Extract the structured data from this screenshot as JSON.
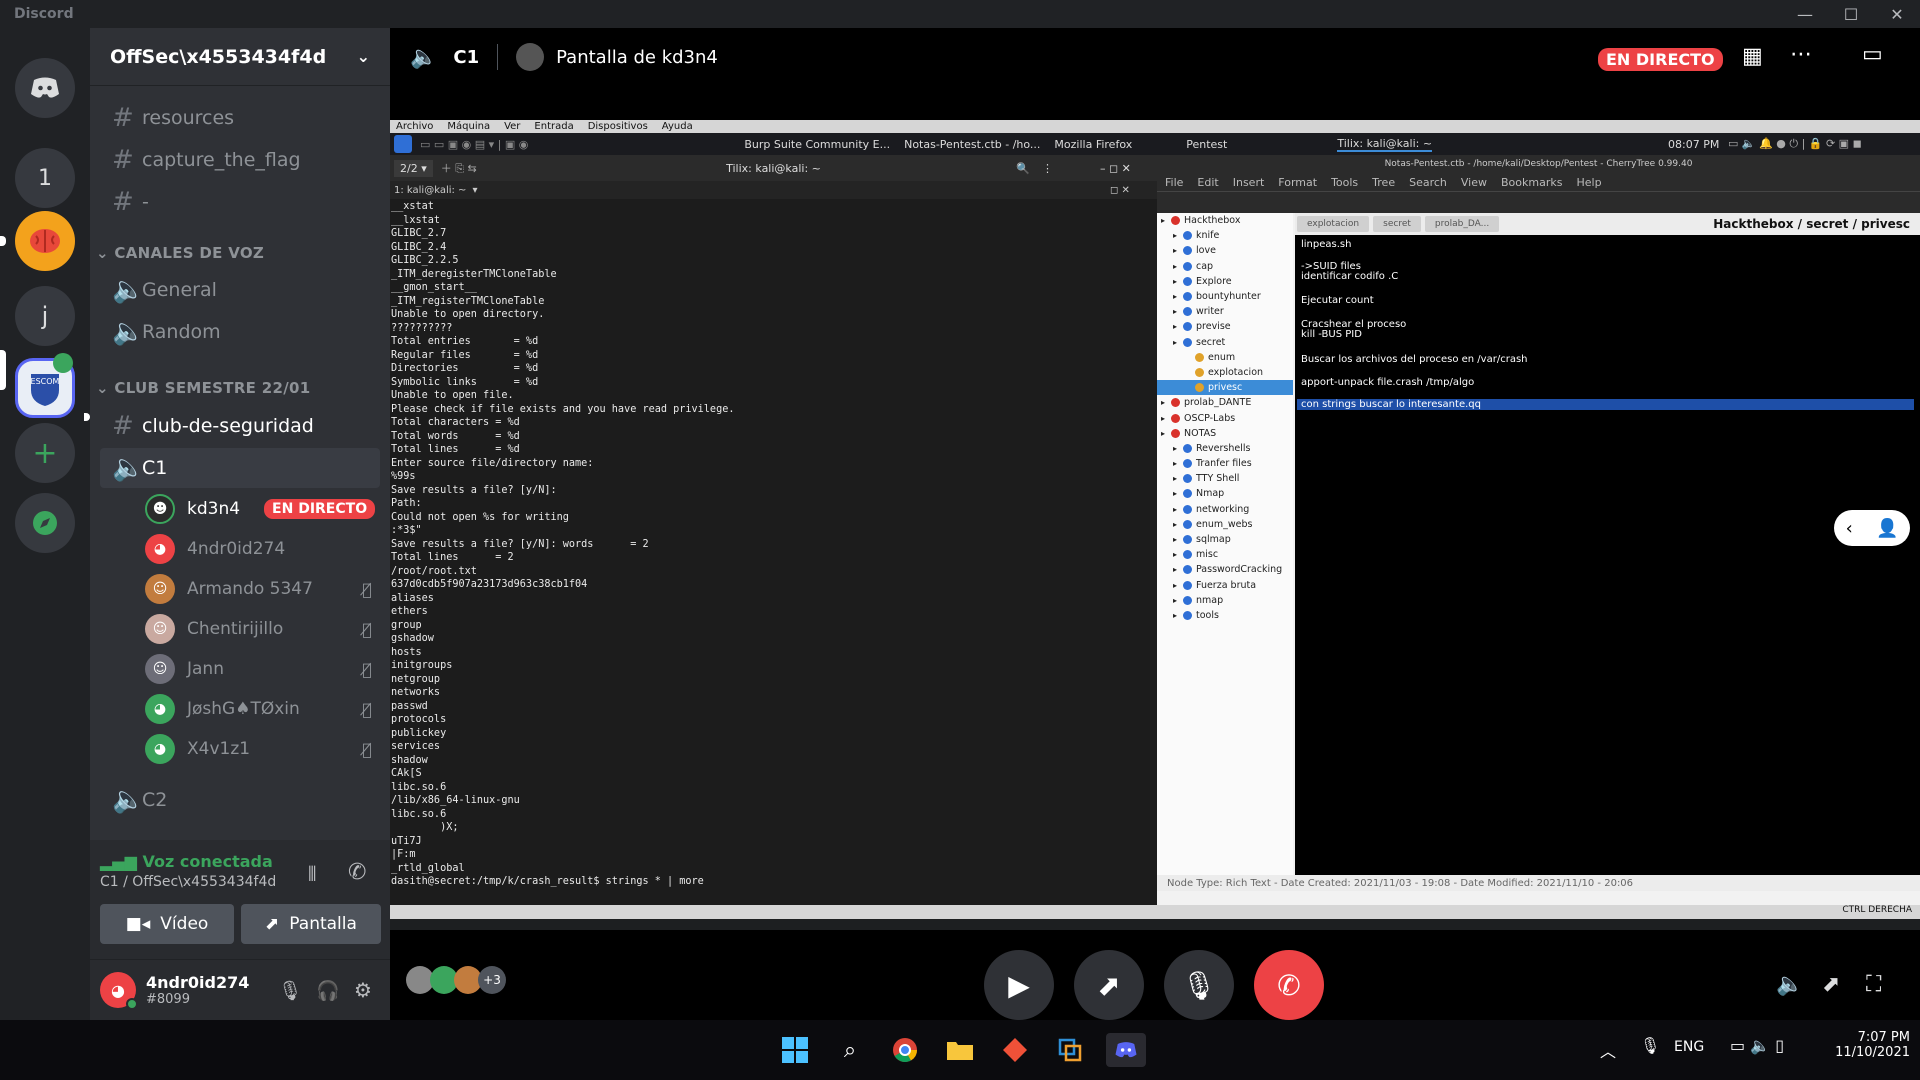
{
  "window": {
    "app_name": "Discord"
  },
  "guilds": [
    {
      "label": "",
      "icon": "discord-home-icon"
    },
    {
      "label": "1"
    },
    {
      "label": ""
    },
    {
      "label": "j"
    },
    {
      "label": "ESCOM"
    }
  ],
  "server": {
    "name": "OffSec\\x4553434f4d"
  },
  "text_channels": [
    "resources",
    "capture_the_flag",
    "-"
  ],
  "voice_category": "CANALES DE VOZ",
  "voice_channels": [
    "General",
    "Random"
  ],
  "club_category": "CLUB SEMESTRE 22/01",
  "club_channel": "club-de-seguridad",
  "c1": {
    "name": "C1",
    "users": [
      {
        "name": "kd3n4",
        "badge": "EN DIRECTO"
      },
      {
        "name": "4ndr0id274"
      },
      {
        "name": "Armando 5347"
      },
      {
        "name": "Chentirijillo"
      },
      {
        "name": "Jann"
      },
      {
        "name": "JøshG♠TØxin"
      },
      {
        "name": "X4v1z1"
      }
    ]
  },
  "c2": {
    "name": "C2"
  },
  "voice_panel": {
    "status": "Voz conectada",
    "location": "C1 / OffSec\\x4553434f4d",
    "video_label": "Vídeo",
    "screen_label": "Pantalla"
  },
  "user_panel": {
    "name": "4ndr0id274",
    "tag": "#8099"
  },
  "topbar": {
    "channel": "C1",
    "stream_title": "Pantalla de kd3n4",
    "live_badge": "EN DIRECTO"
  },
  "stream": {
    "vbox_menu": [
      "Archivo",
      "Máquina",
      "Ver",
      "Entrada",
      "Dispositivos",
      "Ayuda"
    ],
    "tasks": [
      "Burp Suite Community E...",
      "Notas-Pentest.ctb - /ho...",
      "Mozilla Firefox",
      "Pentest",
      "Tilix: kali@kali: ~"
    ],
    "clock": "08:07 PM",
    "terminal": {
      "title": "Tilix: kali@kali: ~",
      "session": "2/2",
      "tab": "1: kali@kali: ~",
      "lines": [
        "__xstat",
        "__lxstat",
        "GLIBC_2.7",
        "GLIBC_2.4",
        "GLIBC_2.2.5",
        "_ITM_deregisterTMCloneTable",
        "__gmon_start__",
        "_ITM_registerTMCloneTable",
        "Unable to open directory.",
        "??????????",
        "Total entries       = %d",
        "Regular files       = %d",
        "Directories         = %d",
        "Symbolic links      = %d",
        "Unable to open file.",
        "Please check if file exists and you have read privilege.",
        "Total characters = %d",
        "Total words      = %d",
        "Total lines      = %d",
        "Enter source file/directory name:",
        "%99s",
        "Save results a file? [y/N]:",
        "Path:",
        "Could not open %s for writing",
        ":*3$\"",
        "Save results a file? [y/N]: words      = 2",
        "Total lines      = 2",
        "/root/root.txt",
        "637d0cdb5f907a23173d963c38cb1f04",
        "aliases",
        "ethers",
        "group",
        "gshadow",
        "hosts",
        "initgroups",
        "netgroup",
        "networks",
        "passwd",
        "protocols",
        "publickey",
        "services",
        "shadow",
        "CAk[S",
        "libc.so.6",
        "/lib/x86_64-linux-gnu",
        "libc.so.6",
        "        )X;",
        "uTi7J",
        "|F:m",
        "_rtld_global",
        "dasith@secret:/tmp/k/crash_result$ strings * | more"
      ]
    },
    "cherrytree": {
      "title": "Notas-Pentest.ctb - /home/kali/Desktop/Pentest - CherryTree 0.99.40",
      "menu": [
        "File",
        "Edit",
        "Insert",
        "Format",
        "Tools",
        "Tree",
        "Search",
        "View",
        "Bookmarks",
        "Help"
      ],
      "tree": [
        {
          "label": "Hackthebox",
          "level": 0,
          "color": "#d9322b"
        },
        {
          "label": "knife",
          "level": 1,
          "color": "#2f6fd6"
        },
        {
          "label": "love",
          "level": 1,
          "color": "#2f6fd6"
        },
        {
          "label": "cap",
          "level": 1,
          "color": "#2f6fd6"
        },
        {
          "label": "Explore",
          "level": 1,
          "color": "#2f6fd6"
        },
        {
          "label": "bountyhunter",
          "level": 1,
          "color": "#2f6fd6"
        },
        {
          "label": "writer",
          "level": 1,
          "color": "#2f6fd6"
        },
        {
          "label": "previse",
          "level": 1,
          "color": "#2f6fd6"
        },
        {
          "label": "secret",
          "level": 1,
          "color": "#2f6fd6"
        },
        {
          "label": "enum",
          "level": 2,
          "color": "#e0a22a"
        },
        {
          "label": "explotacion",
          "level": 2,
          "color": "#e0a22a"
        },
        {
          "label": "privesc",
          "level": 2,
          "color": "#e0a22a"
        },
        {
          "label": "prolab_DANTE",
          "level": 0,
          "color": "#d9322b"
        },
        {
          "label": "OSCP-Labs",
          "level": 0,
          "color": "#d9322b"
        },
        {
          "label": "NOTAS",
          "level": 0,
          "color": "#d9322b"
        },
        {
          "label": "Revershells",
          "level": 1,
          "color": "#2f6fd6"
        },
        {
          "label": "Tranfer files",
          "level": 1,
          "color": "#2f6fd6"
        },
        {
          "label": "TTY Shell",
          "level": 1,
          "color": "#2f6fd6"
        },
        {
          "label": "Nmap",
          "level": 1,
          "color": "#2f6fd6"
        },
        {
          "label": "networking",
          "level": 1,
          "color": "#2f6fd6"
        },
        {
          "label": "enum_webs",
          "level": 1,
          "color": "#2f6fd6"
        },
        {
          "label": "sqlmap",
          "level": 1,
          "color": "#2f6fd6"
        },
        {
          "label": "misc",
          "level": 1,
          "color": "#2f6fd6"
        },
        {
          "label": "PasswordCracking",
          "level": 1,
          "color": "#2f6fd6"
        },
        {
          "label": "Fuerza bruta",
          "level": 1,
          "color": "#2f6fd6"
        },
        {
          "label": "nmap",
          "level": 1,
          "color": "#2f6fd6"
        },
        {
          "label": "tools",
          "level": 1,
          "color": "#2f6fd6"
        }
      ],
      "tabs": [
        "explotacion",
        "secret",
        "prolab_DA..."
      ],
      "breadcrumb": "Hackthebox / secret / privesc",
      "content": [
        "linpeas.sh",
        "->SUID files",
        "identificar codifo .C",
        "Ejecutar count",
        "Cracshear el proceso",
        "kill -BUS PID",
        "Buscar los archivos del proceso en /var/crash",
        "apport-unpack file.crash /tmp/algo",
        "con strings buscar lo interesante.qq"
      ],
      "status": "Node Type: Rich Text  -  Date Created: 2021/11/03 - 19:08  -  Date Modified: 2021/11/10 - 20:06"
    },
    "hostkey": "CTRL DERECHA",
    "overflow_count": "+3"
  },
  "taskbar": {
    "lang": "ENG",
    "time": "7:07 PM",
    "date": "11/10/2021"
  },
  "colors": {
    "accent": "#5865f2",
    "live": "#ed4245",
    "online": "#3ba55d",
    "guild_orange": "#f3a21c"
  }
}
